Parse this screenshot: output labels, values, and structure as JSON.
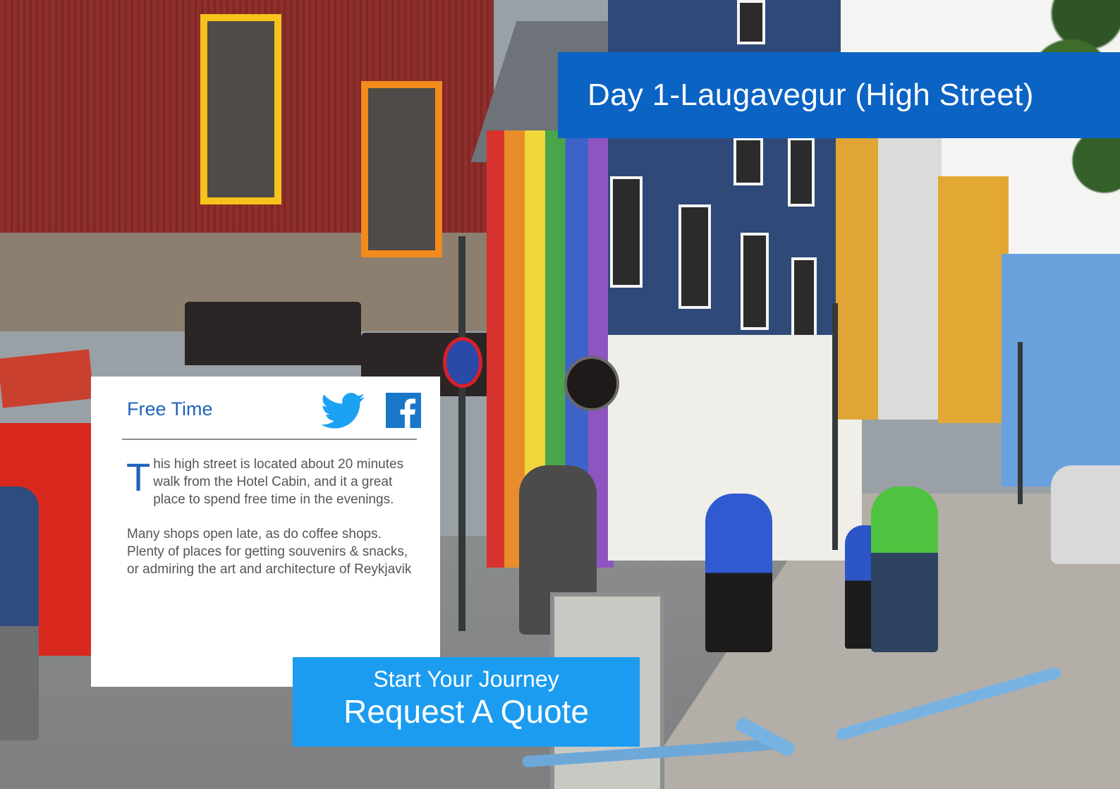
{
  "banner": {
    "title": "Day 1-Laugavegur (High Street)"
  },
  "card": {
    "heading": "Free Time",
    "paragraph1_dropcap": "T",
    "paragraph1_rest": "his high street is located about 20 minutes walk from the Hotel Cabin, and it a great place to spend free time in the evenings.",
    "paragraph2": "Many shops open late, as do coffee shops. Plenty of places for getting souvenirs & snacks, or admiring the art and architecture of Reykjavik"
  },
  "social": {
    "twitter_icon": "twitter-icon",
    "facebook_icon": "facebook-icon"
  },
  "cta": {
    "line1": "Start Your Journey",
    "line2": "Request A Quote"
  },
  "colors": {
    "banner_blue": "#0b63c4",
    "cta_blue": "#1c9cf0",
    "heading_blue": "#1d64b9",
    "twitter_blue": "#1da1f2",
    "facebook_blue": "#1877c9"
  }
}
